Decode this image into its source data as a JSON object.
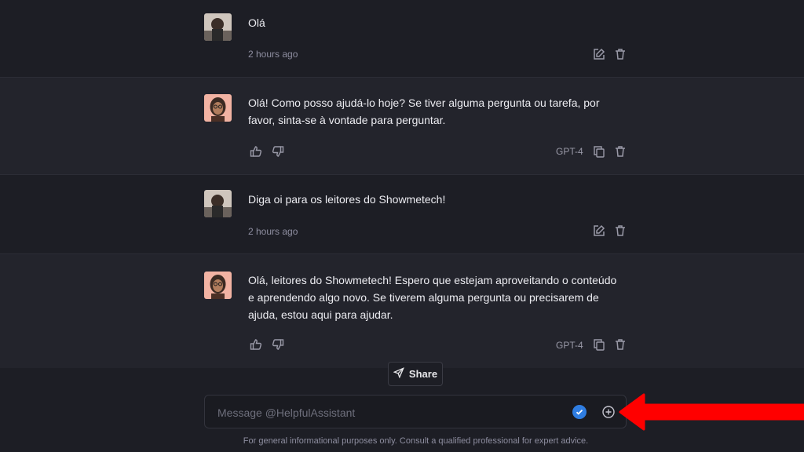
{
  "messages": [
    {
      "role": "user",
      "text": "Olá",
      "timestamp": "2 hours ago"
    },
    {
      "role": "assistant",
      "text": "Olá! Como posso ajudá-lo hoje? Se tiver alguma pergunta ou tarefa, por favor, sinta-se à vontade para perguntar.",
      "model": "GPT-4"
    },
    {
      "role": "user",
      "text": "Diga oi para os leitores do Showmetech!",
      "timestamp": "2 hours ago"
    },
    {
      "role": "assistant",
      "text": "Olá, leitores do Showmetech! Espero que estejam aproveitando o conteúdo e aprendendo algo novo. Se tiverem alguma pergunta ou precisarem de ajuda, estou aqui para ajudar.",
      "model": "GPT-4"
    }
  ],
  "share_label": "Share",
  "composer": {
    "placeholder": "Message @HelpfulAssistant"
  },
  "footer_text": "For general informational purposes only. Consult a qualified professional for expert advice.",
  "colors": {
    "background": "#1d1e25",
    "assistant_row": "#23242c",
    "accent": "#2f7de1",
    "annotation_arrow": "#ff0000"
  },
  "icons": [
    "edit-icon",
    "trash-icon",
    "thumbs-up-icon",
    "thumbs-down-icon",
    "copy-icon",
    "send-icon",
    "check-icon",
    "plus-circle-icon",
    "red-arrow-annotation"
  ]
}
